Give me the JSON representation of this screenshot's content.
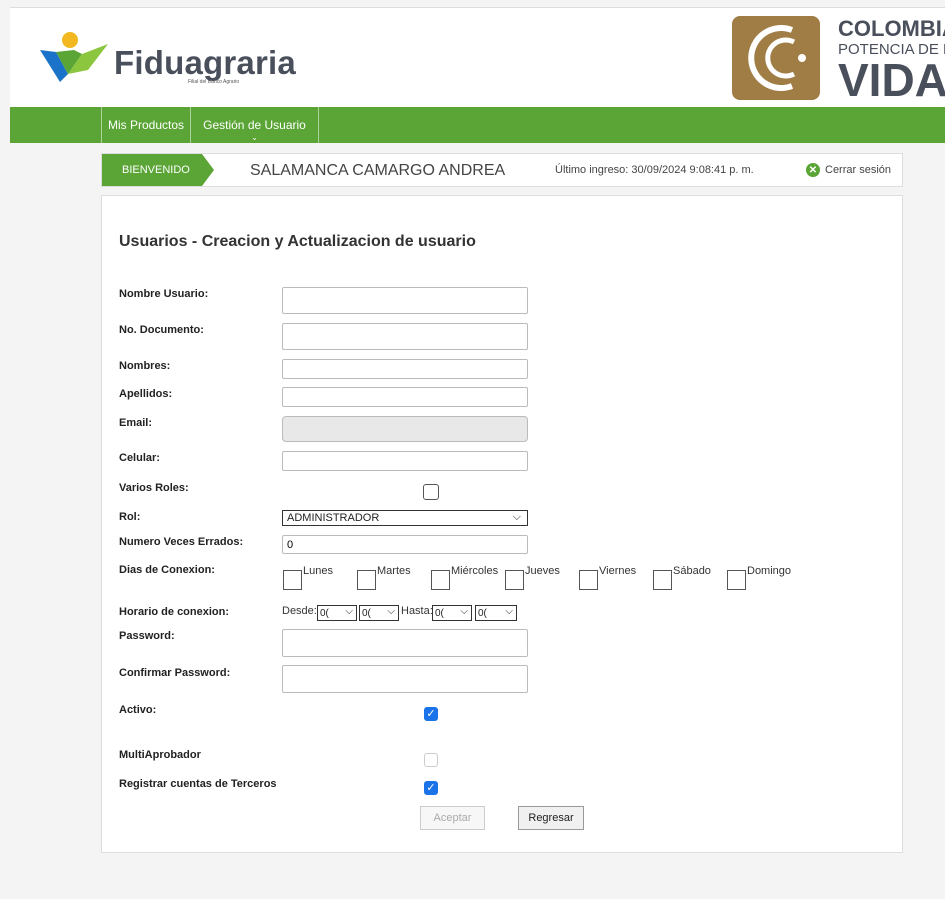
{
  "header": {
    "brand": "Fiduagraria",
    "brand_sub": "Filial del Banco Agrario",
    "gov_line1": "COLOMBIA",
    "gov_line2": "POTENCIA DE LA",
    "gov_line3": "VIDA"
  },
  "nav": {
    "items": [
      {
        "label": "Mis Productos"
      },
      {
        "label": "Gestión de Usuario",
        "chevron": "⌄"
      }
    ]
  },
  "welcome": {
    "badge": "BIENVENIDO",
    "user_name": "SALAMANCA CAMARGO ANDREA",
    "last_login": "Último ingreso: 30/09/2024 9:08:41 p. m.",
    "logout_label": "Cerrar sesión",
    "logout_icon": "✕"
  },
  "form": {
    "title": "Usuarios - Creacion y Actualizacion de usuario",
    "labels": {
      "username": "Nombre Usuario:",
      "document": "No. Documento:",
      "names": "Nombres:",
      "surnames": "Apellidos:",
      "email": "Email:",
      "phone": "Celular:",
      "multi_roles": "Varios Roles:",
      "role": "Rol:",
      "failed_attempts": "Numero Veces Errados:",
      "connection_days": "Dias de Conexion:",
      "connection_hours": "Horario de conexion:",
      "password": "Password:",
      "confirm_password": "Confirmar Password:",
      "active": "Activo:",
      "multi_approver": "MultiAprobador",
      "third_party": "Registrar cuentas de Terceros"
    },
    "values": {
      "username": "",
      "document": "",
      "names": "",
      "surnames": "",
      "email": "",
      "phone": "",
      "role": "ADMINISTRADOR",
      "failed_attempts": "0",
      "password": "",
      "confirm_password": ""
    },
    "checkboxes": {
      "multi_roles": false,
      "active": true,
      "multi_approver": false,
      "third_party": true
    },
    "days": [
      "Lunes",
      "Martes",
      "Miércoles",
      "Jueves",
      "Viernes",
      "Sábado",
      "Domingo"
    ],
    "hours": {
      "from_label": "Desde:",
      "to_label": "Hasta:",
      "from_hour": "0(",
      "from_min": "0(",
      "to_hour": "0(",
      "to_min": "0("
    },
    "buttons": {
      "accept": "Aceptar",
      "back": "Regresar"
    }
  },
  "colors": {
    "brand_green": "#5aa536",
    "check_blue": "#1a73e8",
    "gov_gold": "#a07d45"
  }
}
